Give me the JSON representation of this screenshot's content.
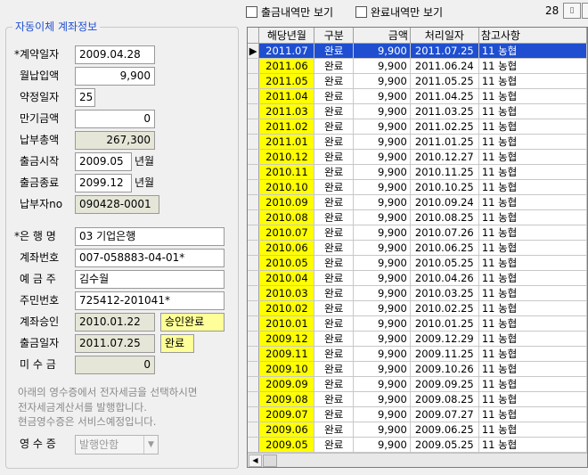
{
  "top": {
    "filter_withdraw": "출금내역만 보기",
    "filter_complete": "완료내역만 보기",
    "count": "28"
  },
  "form": {
    "group_title": "자동이체 계좌정보",
    "contract_date_label": "*계약일자",
    "contract_date": "2009.04.28",
    "monthly_amount_label": "월납입액",
    "monthly_amount": "9,900",
    "promise_day_label": "약정일자",
    "promise_day": "25",
    "maturity_amount_label": "만기금액",
    "maturity_amount": "0",
    "total_paid_label": "납부총액",
    "total_paid": "267,300",
    "withdraw_start_label": "출금시작",
    "withdraw_start": "2009.05",
    "withdraw_start_unit": "년월",
    "withdraw_end_label": "출금종료",
    "withdraw_end": "2099.12",
    "withdraw_end_unit": "년월",
    "payer_no_label": "납부자no",
    "payer_no": "090428-0001",
    "bank_label": "*은 행 명",
    "bank": "03 기업은행",
    "account_no_label": "계좌번호",
    "account_no": "007-058883-04-01*",
    "depositor_label": "예 금 주",
    "depositor": "김수월",
    "resident_no_label": "주민번호",
    "resident_no": "725412-201041*",
    "account_approval_label": "계좌승인",
    "account_approval_date": "2010.01.22",
    "account_approval_status": "승인완료",
    "withdraw_date_label": "출금일자",
    "withdraw_date": "2011.07.25",
    "withdraw_status": "완료",
    "unpaid_label": "미 수 금",
    "unpaid": "0",
    "note_line1": "아래의 영수증에서 전자세금을 선택하시면",
    "note_line2": "전자세금계산서를 발행합니다.",
    "note_line3": "현금영수증은 서비스예정입니다.",
    "receipt_label": "영 수 증",
    "receipt_value": "발행안함"
  },
  "grid": {
    "columns": [
      "해당년월",
      "구분",
      "금액",
      "처리일자",
      "참고사항"
    ],
    "rows": [
      [
        "2011.07",
        "완료",
        "9,900",
        "2011.07.25",
        "11 농협"
      ],
      [
        "2011.06",
        "완료",
        "9,900",
        "2011.06.24",
        "11 농협"
      ],
      [
        "2011.05",
        "완료",
        "9,900",
        "2011.05.25",
        "11 농협"
      ],
      [
        "2011.04",
        "완료",
        "9,900",
        "2011.04.25",
        "11 농협"
      ],
      [
        "2011.03",
        "완료",
        "9,900",
        "2011.03.25",
        "11 농협"
      ],
      [
        "2011.02",
        "완료",
        "9,900",
        "2011.02.25",
        "11 농협"
      ],
      [
        "2011.01",
        "완료",
        "9,900",
        "2011.01.25",
        "11 농협"
      ],
      [
        "2010.12",
        "완료",
        "9,900",
        "2010.12.27",
        "11 농협"
      ],
      [
        "2010.11",
        "완료",
        "9,900",
        "2010.11.25",
        "11 농협"
      ],
      [
        "2010.10",
        "완료",
        "9,900",
        "2010.10.25",
        "11 농협"
      ],
      [
        "2010.09",
        "완료",
        "9,900",
        "2010.09.24",
        "11 농협"
      ],
      [
        "2010.08",
        "완료",
        "9,900",
        "2010.08.25",
        "11 농협"
      ],
      [
        "2010.07",
        "완료",
        "9,900",
        "2010.07.26",
        "11 농협"
      ],
      [
        "2010.06",
        "완료",
        "9,900",
        "2010.06.25",
        "11 농협"
      ],
      [
        "2010.05",
        "완료",
        "9,900",
        "2010.05.25",
        "11 농협"
      ],
      [
        "2010.04",
        "완료",
        "9,900",
        "2010.04.26",
        "11 농협"
      ],
      [
        "2010.03",
        "완료",
        "9,900",
        "2010.03.25",
        "11 농협"
      ],
      [
        "2010.02",
        "완료",
        "9,900",
        "2010.02.25",
        "11 농협"
      ],
      [
        "2010.01",
        "완료",
        "9,900",
        "2010.01.25",
        "11 농협"
      ],
      [
        "2009.12",
        "완료",
        "9,900",
        "2009.12.29",
        "11 농협"
      ],
      [
        "2009.11",
        "완료",
        "9,900",
        "2009.11.25",
        "11 농협"
      ],
      [
        "2009.10",
        "완료",
        "9,900",
        "2009.10.26",
        "11 농협"
      ],
      [
        "2009.09",
        "완료",
        "9,900",
        "2009.09.25",
        "11 농협"
      ],
      [
        "2009.08",
        "완료",
        "9,900",
        "2009.08.25",
        "11 농협"
      ],
      [
        "2009.07",
        "완료",
        "9,900",
        "2009.07.27",
        "11 농협"
      ],
      [
        "2009.06",
        "완료",
        "9,900",
        "2009.06.25",
        "11 농협"
      ],
      [
        "2009.05",
        "완료",
        "9,900",
        "2009.05.25",
        "11 농협"
      ]
    ]
  },
  "colors": {
    "selection": "#1f4fd0",
    "month_highlight": "#ffff00",
    "status_highlight": "#ffff99",
    "group_title": "#1f4fd0"
  }
}
